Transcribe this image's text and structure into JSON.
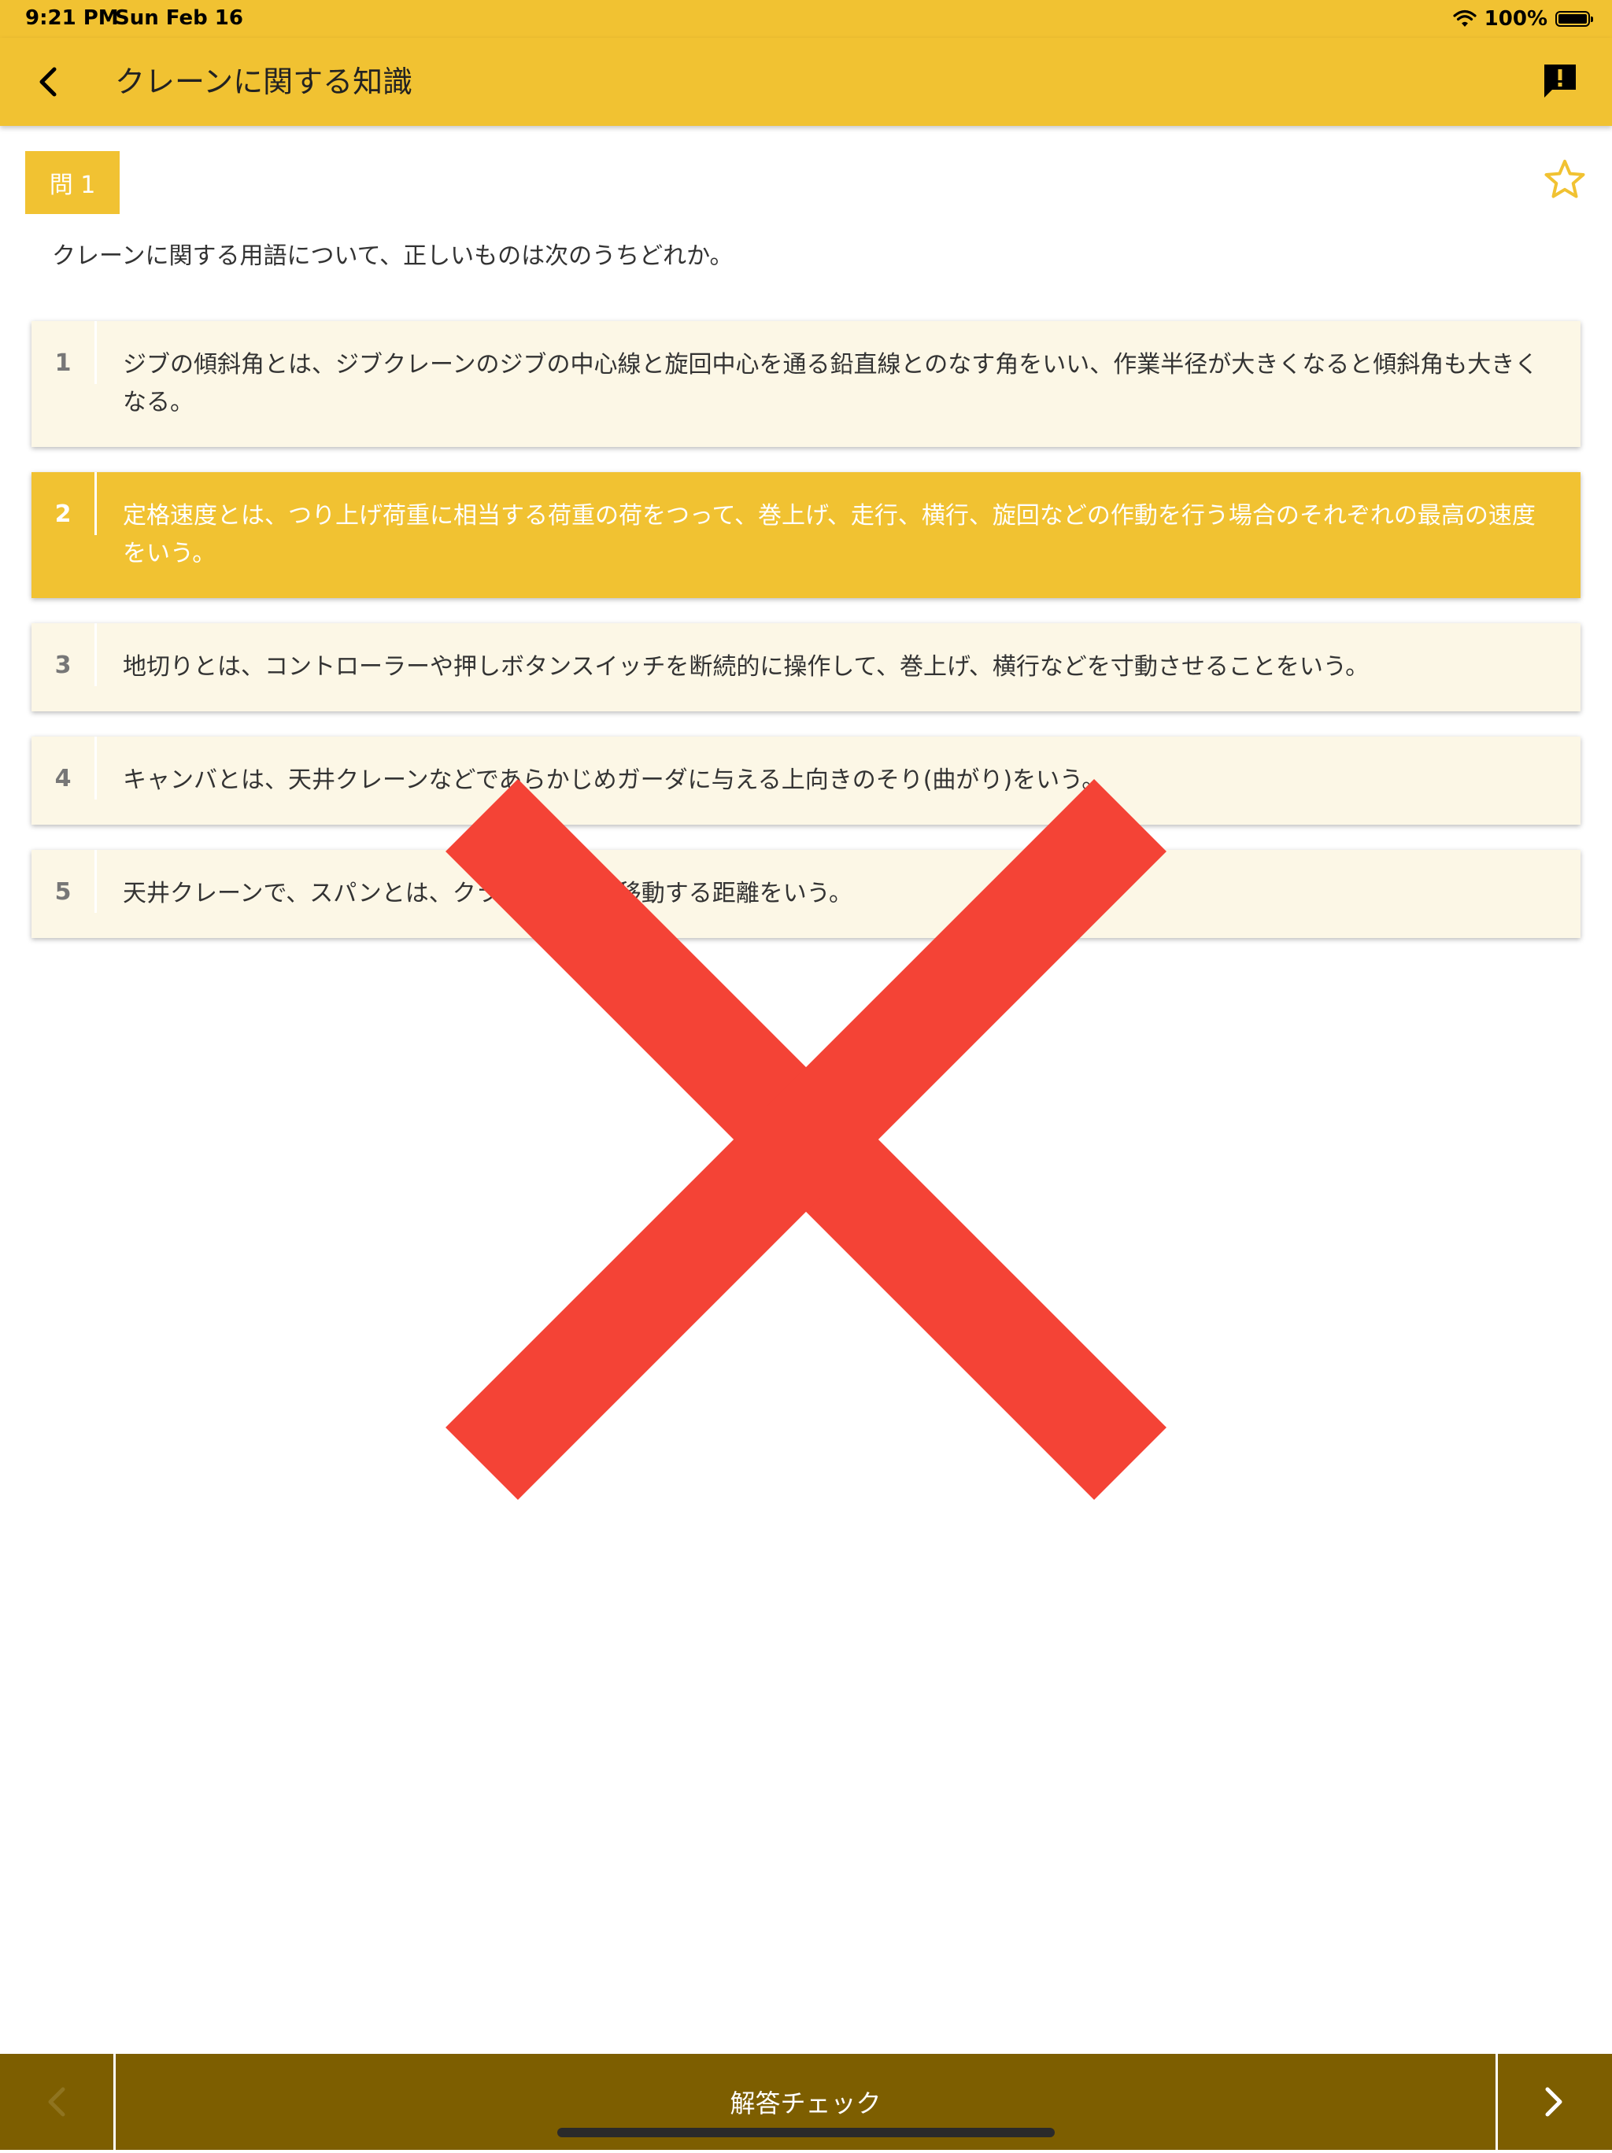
{
  "status_bar": {
    "time": "9:21 PM",
    "date": "Sun Feb 16",
    "battery": "100%"
  },
  "nav": {
    "title": "クレーンに関する知識"
  },
  "question": {
    "badge": "問 1",
    "text": "クレーンに関する用語について、正しいものは次のうちどれか。"
  },
  "choices": [
    {
      "num": "1",
      "text": "ジブの傾斜角とは、ジブクレーンのジブの中心線と旋回中心を通る鉛直線とのなす角をいい、作業半径が大きくなると傾斜角も大きくなる。",
      "selected": false
    },
    {
      "num": "2",
      "text": "定格速度とは、つり上げ荷重に相当する荷重の荷をつって、巻上げ、走行、横行、旋回などの作動を行う場合のそれぞれの最高の速度をいう。",
      "selected": true
    },
    {
      "num": "3",
      "text": "地切りとは、コントローラーや押しボタンスイッチを断続的に操作して、巻上げ、横行などを寸動させることをいう。",
      "selected": false
    },
    {
      "num": "4",
      "text": "キャンバとは、天井クレーンなどであらかじめガーダに与える上向きのそり(曲がり)をいう。",
      "selected": false
    },
    {
      "num": "5",
      "text": "天井クレーンで、スパンとは、クラブトロリの移動する距離をいう。",
      "selected": false
    }
  ],
  "result": {
    "mark": "incorrect-x",
    "color": "#f44336"
  },
  "toolbar": {
    "check_label": "解答チェック"
  },
  "colors": {
    "accent": "#f1c232",
    "toolbar": "#7d5e00",
    "choice_bg": "#fcf7e6"
  },
  "icons": {
    "back": "chevron-left-icon",
    "report": "report-icon",
    "favorite": "star-outline-icon",
    "prev": "chevron-left-icon",
    "next": "chevron-right-icon"
  }
}
